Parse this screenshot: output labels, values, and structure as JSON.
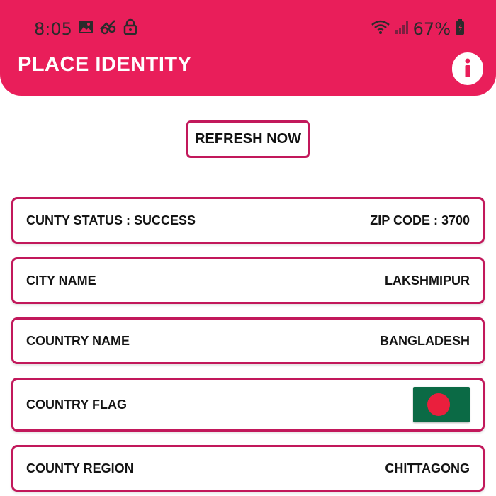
{
  "status_bar": {
    "time": "8:05",
    "battery": "67%"
  },
  "app": {
    "title": "PLACE IDENTITY"
  },
  "actions": {
    "refresh_label": "REFRESH NOW"
  },
  "rows": [
    {
      "label": "CUNTY STATUS : SUCCESS",
      "value": "ZIP CODE : 3700"
    },
    {
      "label": "CITY NAME",
      "value": "LAKSHMIPUR"
    },
    {
      "label": "COUNTRY NAME",
      "value": "BANGLADESH"
    },
    {
      "label": "COUNTRY FLAG",
      "value": ""
    },
    {
      "label": "COUNTY REGION",
      "value": "CHITTAGONG"
    }
  ],
  "colors": {
    "accent": "#e91e5a",
    "card_border": "#c2185b",
    "flag_green": "#0b6a45",
    "flag_red": "#ea1f3d"
  },
  "icons": {
    "status_left": [
      "image-icon",
      "link-icon",
      "lock-icon"
    ],
    "status_right": [
      "wifi-icon",
      "signal-icon",
      "battery-icon"
    ],
    "appbar": "info-icon"
  }
}
